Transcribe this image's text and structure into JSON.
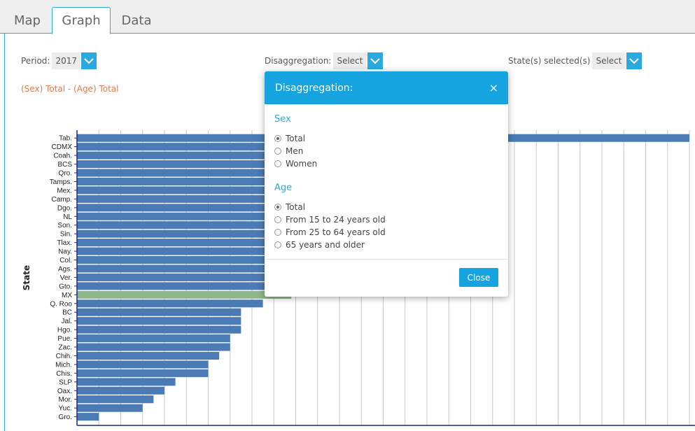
{
  "tabs": [
    {
      "label": "Map"
    },
    {
      "label": "Graph"
    },
    {
      "label": "Data"
    }
  ],
  "controls": {
    "period_label": "Period:",
    "period_value": "2017",
    "disaggregation_label": "Disaggregation:",
    "disaggregation_value": "Select",
    "states_label": "State(s) selected(s)",
    "states_value": "Select"
  },
  "subtitle": "(Sex) Total - (Age) Total",
  "modal": {
    "title": "Disaggregation:",
    "close_x": "×",
    "sex_heading": "Sex",
    "sex_options": [
      "Total",
      "Men",
      "Women"
    ],
    "sex_selected": "Total",
    "age_heading": "Age",
    "age_options": [
      "Total",
      "From 15 to 24 years old",
      "From 25 to 64 years old",
      "65 years and older"
    ],
    "age_selected": "Total",
    "close_button": "Close"
  },
  "colors": {
    "accent": "#15a4e0",
    "bar": "#4a7bb5",
    "bar_highlight": "#8fb58a",
    "subtitle": "#e07a4a"
  },
  "chart_data": {
    "type": "bar",
    "orientation": "horizontal",
    "ylabel": "State",
    "xlim": [
      0,
      28
    ],
    "categories": [
      "Tab.",
      "CDMX",
      "Coah.",
      "BCS",
      "Qro.",
      "Tamps.",
      "Mex.",
      "Camp.",
      "Dgo.",
      "NL",
      "Son.",
      "Sin.",
      "Tlax.",
      "Nay.",
      "Col.",
      "Ags.",
      "Ver.",
      "Gto.",
      "MX",
      "Q. Roo",
      "BC",
      "Jal.",
      "Hgo.",
      "Pue.",
      "Zac.",
      "Chih.",
      "Mich.",
      "Chis.",
      "SLP",
      "Oax.",
      "Mor.",
      "Yuc.",
      "Gro."
    ],
    "values": [
      28,
      11.5,
      11,
      11,
      10.8,
      10.6,
      10.5,
      10.4,
      10.2,
      10.1,
      10.0,
      9.9,
      9.8,
      9.6,
      9.4,
      9.2,
      9.0,
      8.8,
      9.8,
      8.5,
      7.5,
      7.5,
      7.5,
      7.0,
      7.0,
      6.5,
      6.0,
      6.0,
      4.5,
      4.0,
      3.5,
      3.0,
      1.0
    ],
    "highlight": "MX",
    "grid": true
  }
}
